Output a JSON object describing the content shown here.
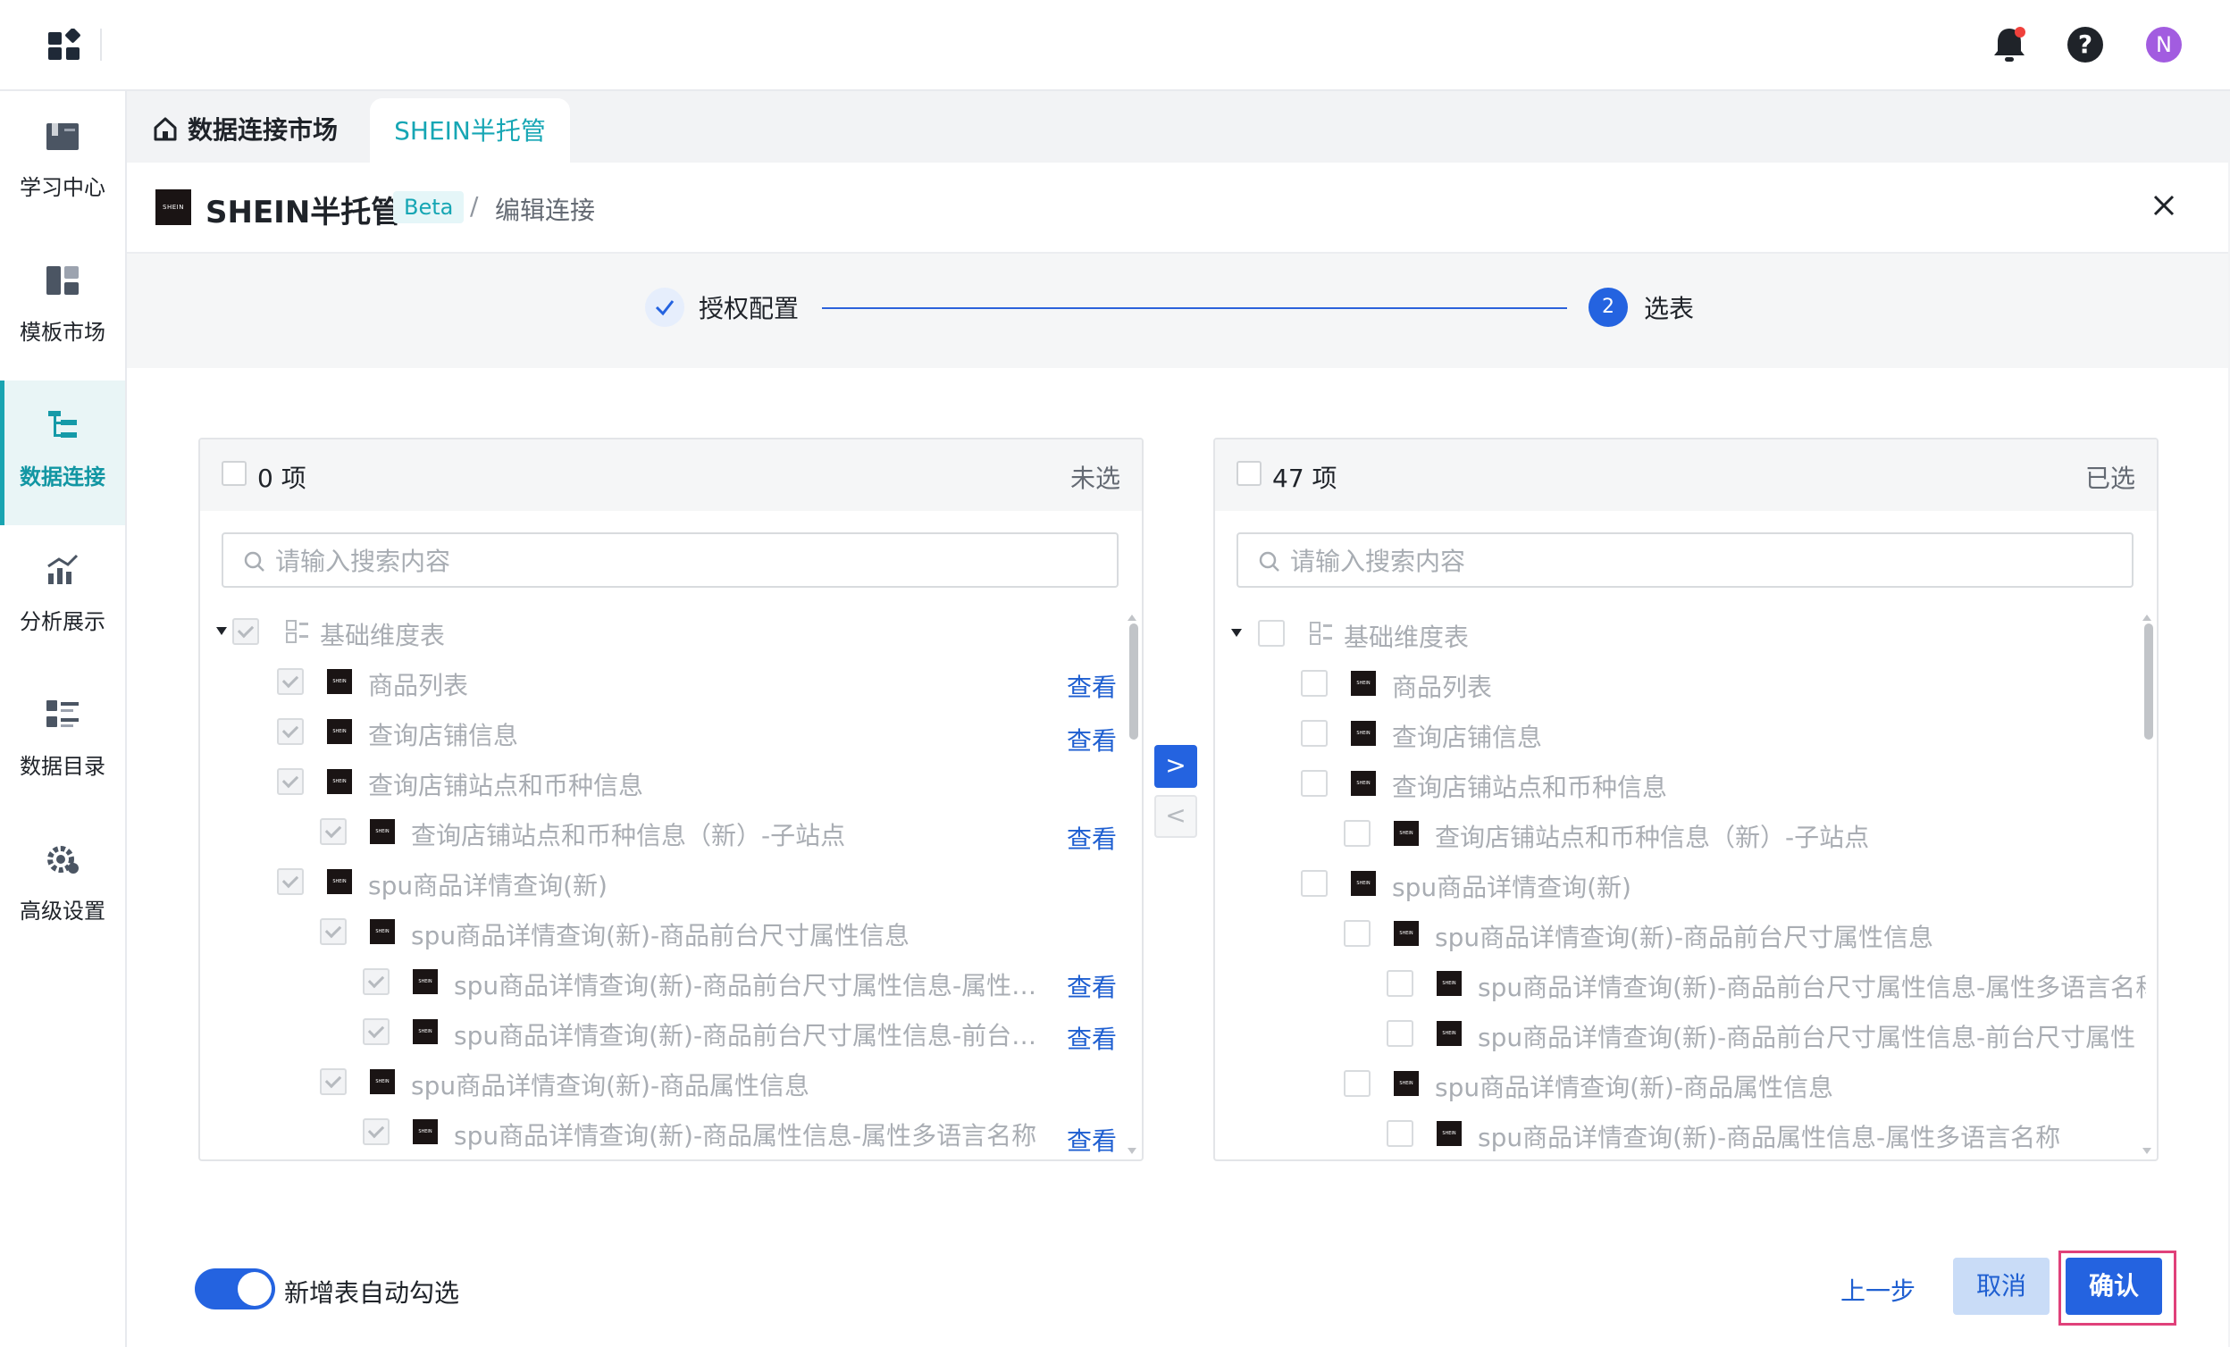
{
  "colors": {
    "accent": "#2463e0",
    "teal": "#16a6b4",
    "link": "#1f5fd1",
    "highlight": "#e0417a"
  },
  "topbar": {
    "avatar_letter": "N"
  },
  "sidebar": {
    "items": [
      {
        "label": "学习中心",
        "icon": "book-icon"
      },
      {
        "label": "模板市场",
        "icon": "template-icon"
      },
      {
        "label": "数据连接",
        "icon": "data-connect-icon",
        "active": true
      },
      {
        "label": "分析展示",
        "icon": "analytics-icon"
      },
      {
        "label": "数据目录",
        "icon": "catalog-icon"
      },
      {
        "label": "高级设置",
        "icon": "settings-gear-icon"
      }
    ]
  },
  "tabs": {
    "home": "数据连接市场",
    "active": "SHEIN半托管"
  },
  "header": {
    "logo_text": "SHEIN",
    "title": "SHEIN半托管",
    "badge": "Beta",
    "separator": "/",
    "crumb": "编辑连接"
  },
  "steps": [
    {
      "label": "授权配置",
      "status": "done"
    },
    {
      "label": "选表",
      "number": "2",
      "status": "current"
    }
  ],
  "transfer": {
    "left": {
      "count": "0 项",
      "state": "未选",
      "placeholder": "请输入搜索内容",
      "root": "基础维度表",
      "rows": [
        "商品列表",
        "查询店铺信息",
        "查询店铺站点和币种信息",
        "查询店铺站点和币种信息（新）-子站点",
        "spu商品详情查询(新)",
        "spu商品详情查询(新)-商品前台尺寸属性信息",
        "spu商品详情查询(新)-商品前台尺寸属性信息-属性多语言名称",
        "spu商品详情查询(新)-商品前台尺寸属性信息-前台尺寸属性",
        "spu商品详情查询(新)-商品属性信息",
        "spu商品详情查询(新)-商品属性信息-属性多语言名称"
      ],
      "view_label": "查看"
    },
    "right": {
      "count": "47 项",
      "state": "已选",
      "placeholder": "请输入搜索内容",
      "root": "基础维度表",
      "rows": [
        "商品列表",
        "查询店铺信息",
        "查询店铺站点和币种信息",
        "查询店铺站点和币种信息（新）-子站点",
        "spu商品详情查询(新)",
        "spu商品详情查询(新)-商品前台尺寸属性信息",
        "spu商品详情查询(新)-商品前台尺寸属性信息-属性多语言名称",
        "spu商品详情查询(新)-商品前台尺寸属性信息-前台尺寸属性",
        "spu商品详情查询(新)-商品属性信息",
        "spu商品详情查询(新)-商品属性信息-属性多语言名称"
      ]
    },
    "move_right": ">",
    "move_left": "<"
  },
  "footer": {
    "toggle_label": "新增表自动勾选",
    "toggle_on": true,
    "prev": "上一步",
    "cancel": "取消",
    "confirm": "确认"
  }
}
